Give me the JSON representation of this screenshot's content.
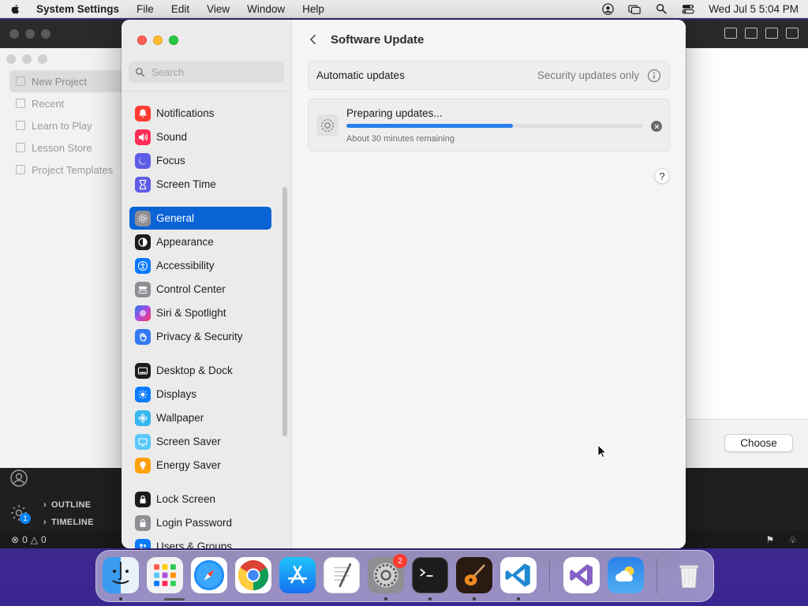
{
  "menubar": {
    "app_name": "System Settings",
    "menus": [
      "File",
      "Edit",
      "View",
      "Window",
      "Help"
    ],
    "clock": "Wed Jul 5  5:04 PM",
    "status_icons": [
      "user-account-icon",
      "screen-mirroring-icon",
      "spotlight-search-icon",
      "control-center-icon"
    ]
  },
  "background": {
    "dialog_sidebar": [
      "New Project",
      "Recent",
      "Learn to Play",
      "Lesson Store",
      "Project Templates"
    ],
    "choose_label": "Choose",
    "vscode_sections": [
      "OUTLINE",
      "TIMELINE"
    ],
    "settings_badge": "1",
    "status_errors": "0",
    "status_warnings": "0"
  },
  "settings": {
    "search_placeholder": "Search",
    "sidebar": [
      {
        "label": "Notifications",
        "icon": "bell-icon",
        "color": "#fe3b30"
      },
      {
        "label": "Sound",
        "icon": "speaker-icon",
        "color": "#fe2d55"
      },
      {
        "label": "Focus",
        "icon": "moon-icon",
        "color": "#5e5ce6"
      },
      {
        "label": "Screen Time",
        "icon": "hourglass-icon",
        "color": "#5e5ce6"
      },
      {
        "label": "General",
        "icon": "gear-icon",
        "color": "#8e8e93"
      },
      {
        "label": "Appearance",
        "icon": "appearance-icon",
        "color": "#1c1c1e"
      },
      {
        "label": "Accessibility",
        "icon": "accessibility-icon",
        "color": "#0a7aff"
      },
      {
        "label": "Control Center",
        "icon": "control-center-icon",
        "color": "#8e8e93"
      },
      {
        "label": "Siri & Spotlight",
        "icon": "siri-icon",
        "color": "#b04ae0"
      },
      {
        "label": "Privacy & Security",
        "icon": "hand-icon",
        "color": "#3478f6"
      },
      {
        "label": "Desktop & Dock",
        "icon": "dock-icon",
        "color": "#1c1c1e"
      },
      {
        "label": "Displays",
        "icon": "sun-icon",
        "color": "#0a7aff"
      },
      {
        "label": "Wallpaper",
        "icon": "flower-icon",
        "color": "#35b6f0"
      },
      {
        "label": "Screen Saver",
        "icon": "screen-saver-icon",
        "color": "#5ac8fa"
      },
      {
        "label": "Energy Saver",
        "icon": "bulb-icon",
        "color": "#ff9f0a"
      },
      {
        "label": "Lock Screen",
        "icon": "lock-icon",
        "color": "#1c1c1e"
      },
      {
        "label": "Login Password",
        "icon": "padlock-icon",
        "color": "#8e8e93"
      },
      {
        "label": "Users & Groups",
        "icon": "users-icon",
        "color": "#0a7aff"
      }
    ],
    "selected": "General",
    "page_title": "Software Update",
    "automatic_updates_label": "Automatic updates",
    "automatic_updates_value": "Security updates only",
    "update_status": "Preparing updates...",
    "update_progress": 0.56,
    "update_remaining": "About 30 minutes remaining",
    "help_label": "?"
  },
  "dock": {
    "apps": [
      "Finder",
      "Launchpad",
      "Safari",
      "Google Chrome",
      "App Store",
      "TextEdit",
      "System Settings",
      "Terminal",
      "GarageBand",
      "Visual Studio Code",
      "Visual Studio",
      "Weather",
      "Trash"
    ],
    "system_settings_badge": "2"
  }
}
